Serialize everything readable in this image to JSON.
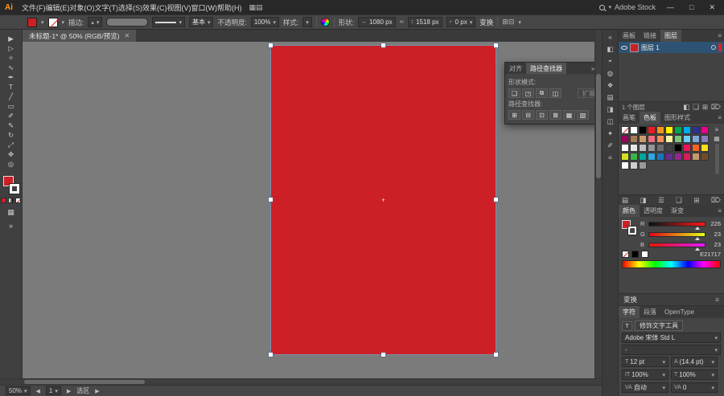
{
  "glyphs": {
    "caret": "▾",
    "caret_up": "▴",
    "panel_menu": "≡",
    "hamburger": "☰",
    "collapse_left": "«",
    "collapse_right": "»",
    "close": "✕",
    "link": "∞",
    "left_arrow": "◀",
    "right_arrow": "▶",
    "width_icon": "↔",
    "height_icon": "↕",
    "corner_icon": "⌐",
    "grid": "▦",
    "list": "≡",
    "plus": "+"
  },
  "app": {
    "logo": "Ai",
    "menus": [
      "文件(F)",
      "编辑(E)",
      "对象(O)",
      "文字(T)",
      "选择(S)",
      "效果(C)",
      "视图(V)",
      "窗口(W)",
      "帮助(H)"
    ],
    "menubar_icons": [
      {
        "name": "arrange-documents-icon",
        "glyph": "▦"
      },
      {
        "name": "workspace-switcher-icon",
        "glyph": "▤"
      }
    ],
    "stock_label": "Adobe Stock",
    "window": {
      "minimize": "—",
      "restore": "□",
      "close": "✕"
    }
  },
  "control_bar": {
    "stroke_label": "描边:",
    "brush_value": "基本",
    "opacity_label": "不透明度:",
    "opacity_value": "100%",
    "style_label": "样式:",
    "shape_label": "形状:",
    "width_value": "1080 px",
    "height_value": "1518 px",
    "corner_value": "0 px",
    "transform_button": "变换",
    "extra_icons": [
      {
        "name": "align-horizontal-icon",
        "glyph": "⊞"
      },
      {
        "name": "align-vertical-icon",
        "glyph": "⊟"
      }
    ]
  },
  "document": {
    "tab_title": "未标题-1* @ 50% (RGB/预览)"
  },
  "toolbar": {
    "tools": [
      {
        "name": "selection-tool",
        "glyph": "▶"
      },
      {
        "name": "direct-selection-tool",
        "glyph": "▷"
      },
      {
        "name": "magic-wand-tool",
        "glyph": "✧"
      },
      {
        "name": "lasso-tool",
        "glyph": "∿"
      },
      {
        "name": "pen-tool",
        "glyph": "✒"
      },
      {
        "name": "type-tool",
        "glyph": "T"
      },
      {
        "name": "line-segment-tool",
        "glyph": "╱"
      },
      {
        "name": "rectangle-tool",
        "glyph": "▭"
      },
      {
        "name": "paintbrush-tool",
        "glyph": "✐"
      },
      {
        "name": "pencil-tool",
        "glyph": "✎"
      },
      {
        "name": "rotate-tool",
        "glyph": "↻"
      },
      {
        "name": "scale-tool",
        "glyph": "⤢"
      },
      {
        "name": "hand-tool",
        "glyph": "✥"
      },
      {
        "name": "zoom-tool",
        "glyph": "◎"
      }
    ]
  },
  "canvas": {
    "artboard_color": "#cd2026"
  },
  "pathfinder": {
    "tabs": [
      "对齐",
      "路径查找器"
    ],
    "shape_modes_label": "形状模式:",
    "shape_mode_buttons": [
      {
        "name": "unite-icon",
        "glyph": "❏"
      },
      {
        "name": "minus-front-icon",
        "glyph": "◳"
      },
      {
        "name": "intersect-icon",
        "glyph": "⧉"
      },
      {
        "name": "exclude-icon",
        "glyph": "◫"
      }
    ],
    "expand_button": "扩展",
    "pathfinders_label": "路径查找器:",
    "pathfinder_buttons": [
      {
        "name": "divide-icon",
        "glyph": "⊞"
      },
      {
        "name": "trim-icon",
        "glyph": "⊟"
      },
      {
        "name": "merge-icon",
        "glyph": "⊡"
      },
      {
        "name": "crop-icon",
        "glyph": "⊠"
      },
      {
        "name": "outline-icon",
        "glyph": "▦"
      },
      {
        "name": "minus-back-icon",
        "glyph": "▧"
      }
    ]
  },
  "dock": {
    "strip_icons": [
      {
        "name": "color-panel-icon",
        "glyph": "◧"
      },
      {
        "name": "color-guide-panel-icon",
        "glyph": "◓"
      },
      {
        "name": "appearance-panel-icon",
        "glyph": "◍"
      },
      {
        "name": "graphic-styles-panel-icon",
        "glyph": "❖"
      },
      {
        "name": "info-panel-icon",
        "glyph": "▤"
      },
      {
        "name": "gradient-panel-icon",
        "glyph": "◨"
      },
      {
        "name": "transparency-panel-icon",
        "glyph": "◫"
      },
      {
        "name": "symbols-panel-icon",
        "glyph": "✦"
      },
      {
        "name": "brushes-panel-icon",
        "glyph": "✐"
      },
      {
        "name": "navigator-panel-icon",
        "glyph": "⌗"
      }
    ],
    "layers_panel": {
      "tabs": [
        "画板",
        "链接",
        "图层"
      ],
      "layer_name": "图层 1",
      "layer_count": "1 个图层",
      "bottom_icons": [
        {
          "name": "make-clipping-mask-icon",
          "glyph": "◧"
        },
        {
          "name": "new-sublayer-icon",
          "glyph": "❏"
        },
        {
          "name": "new-layer-icon",
          "glyph": "⊞"
        },
        {
          "name": "delete-layer-icon",
          "glyph": "⌦"
        }
      ]
    },
    "swatches_panel": {
      "tabs": [
        "画笔",
        "色板",
        "图形样式"
      ],
      "cells": [
        "none",
        "#ffffff",
        "#000000",
        "#ed1c24",
        "#f7941d",
        "#fff200",
        "#00a651",
        "#00aeef",
        "#2e3192",
        "#ec008c",
        "#9e005d",
        "#a67c52",
        "#c69c6d",
        "#f26d7d",
        "#f68e56",
        "#fbf5a2",
        "#7cc576",
        "#6dcff6",
        "#7da7d9",
        "#8781bd",
        "#ffffff",
        "#e6e7e8",
        "#bcbec0",
        "#939598",
        "#6d6e71",
        "#414042",
        "#000000",
        "#ed145b",
        "#f26522",
        "#ffde17",
        "#d7df23",
        "#39b54a",
        "#00a79d",
        "#27aae1",
        "#1b75bc",
        "#662d91",
        "#92278f",
        "#da1c5c",
        "#c49a6c",
        "#754c29",
        "#ffffff",
        "#cccccc",
        "#999999",
        "",
        "",
        "",
        "",
        "",
        "",
        ""
      ],
      "bottom_icons": [
        {
          "name": "swatch-libraries-icon",
          "glyph": "▤"
        },
        {
          "name": "color-themes-icon",
          "glyph": "◨"
        },
        {
          "name": "show-swatch-kinds-icon",
          "glyph": "☰"
        },
        {
          "name": "new-color-group-icon",
          "glyph": "❑"
        },
        {
          "name": "new-swatch-icon",
          "glyph": "⊞"
        },
        {
          "name": "delete-swatch-icon",
          "glyph": "⌦"
        }
      ]
    },
    "color_panel": {
      "tabs": [
        "颜色",
        "透明度",
        "渐变"
      ],
      "sliders": [
        {
          "label": "R",
          "value": "226"
        },
        {
          "label": "G",
          "value": "23"
        },
        {
          "label": "B",
          "value": "23"
        }
      ],
      "hex": "E21717"
    },
    "transform_panel": {
      "title": "变换"
    },
    "type_panel": {
      "tabs": [
        "字符",
        "段落",
        "OpenType"
      ],
      "touch_type_button": "修饰文字工具",
      "font_family": "Adobe 宋体 Std L",
      "font_style": "-",
      "rows": [
        {
          "left_icon": "T",
          "left_value": "12 pt",
          "right_icon": "A",
          "right_value": "(14.4 pt)"
        },
        {
          "left_icon": "IT",
          "left_value": "100%",
          "right_icon": "T",
          "right_value": "100%"
        },
        {
          "left_icon": "VA",
          "left_value": "自动",
          "right_icon": "VA",
          "right_value": "0"
        }
      ]
    }
  },
  "status_bar": {
    "zoom": "50%",
    "artboard_value": "1",
    "status": "选区"
  }
}
